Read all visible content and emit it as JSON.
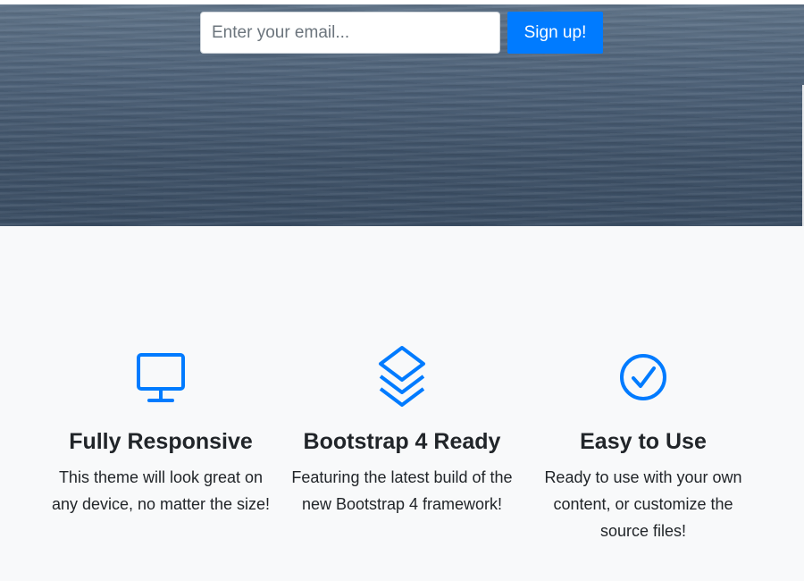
{
  "signup": {
    "email_placeholder": "Enter your email...",
    "button_label": "Sign up!"
  },
  "features": [
    {
      "icon": "monitor-icon",
      "title": "Fully Responsive",
      "text": "This theme will look great on any device, no matter the size!"
    },
    {
      "icon": "layers-icon",
      "title": "Bootstrap 4 Ready",
      "text": "Featuring the latest build of the new Bootstrap 4 framework!"
    },
    {
      "icon": "check-circle-icon",
      "title": "Easy to Use",
      "text": "Ready to use with your own content, or customize the source files!"
    }
  ],
  "colors": {
    "accent": "#007bff",
    "section_background": "#f8f9fa",
    "text": "#212529"
  }
}
